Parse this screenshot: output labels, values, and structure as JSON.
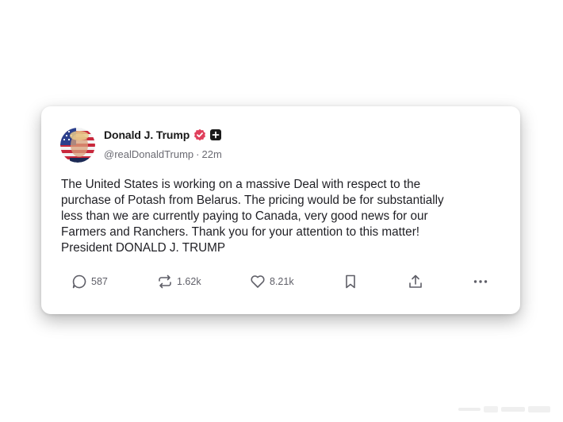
{
  "post": {
    "author_name": "Donald J. Trump",
    "author_handle": "@realDonaldTrump",
    "separator": "·",
    "time_ago": "22m",
    "body": "The United States is working on a massive Deal with respect to the\npurchase of Potash from Belarus. The pricing would be for substantially\nless than we are currently paying to Canada, very good news for our\nFarmers and Ranchers. Thank you for your attention to this matter!\nPresident DONALD J. TRUMP",
    "verified_color": "#e0405c"
  },
  "actions": {
    "reply_icon": "reply-icon",
    "reply_count": "587",
    "repost_icon": "repost-icon",
    "repost_count": "1.62k",
    "like_icon": "heart-icon",
    "like_count": "8.21k",
    "bookmark_icon": "bookmark-icon",
    "share_icon": "share-icon",
    "more_icon": "more-icon"
  }
}
